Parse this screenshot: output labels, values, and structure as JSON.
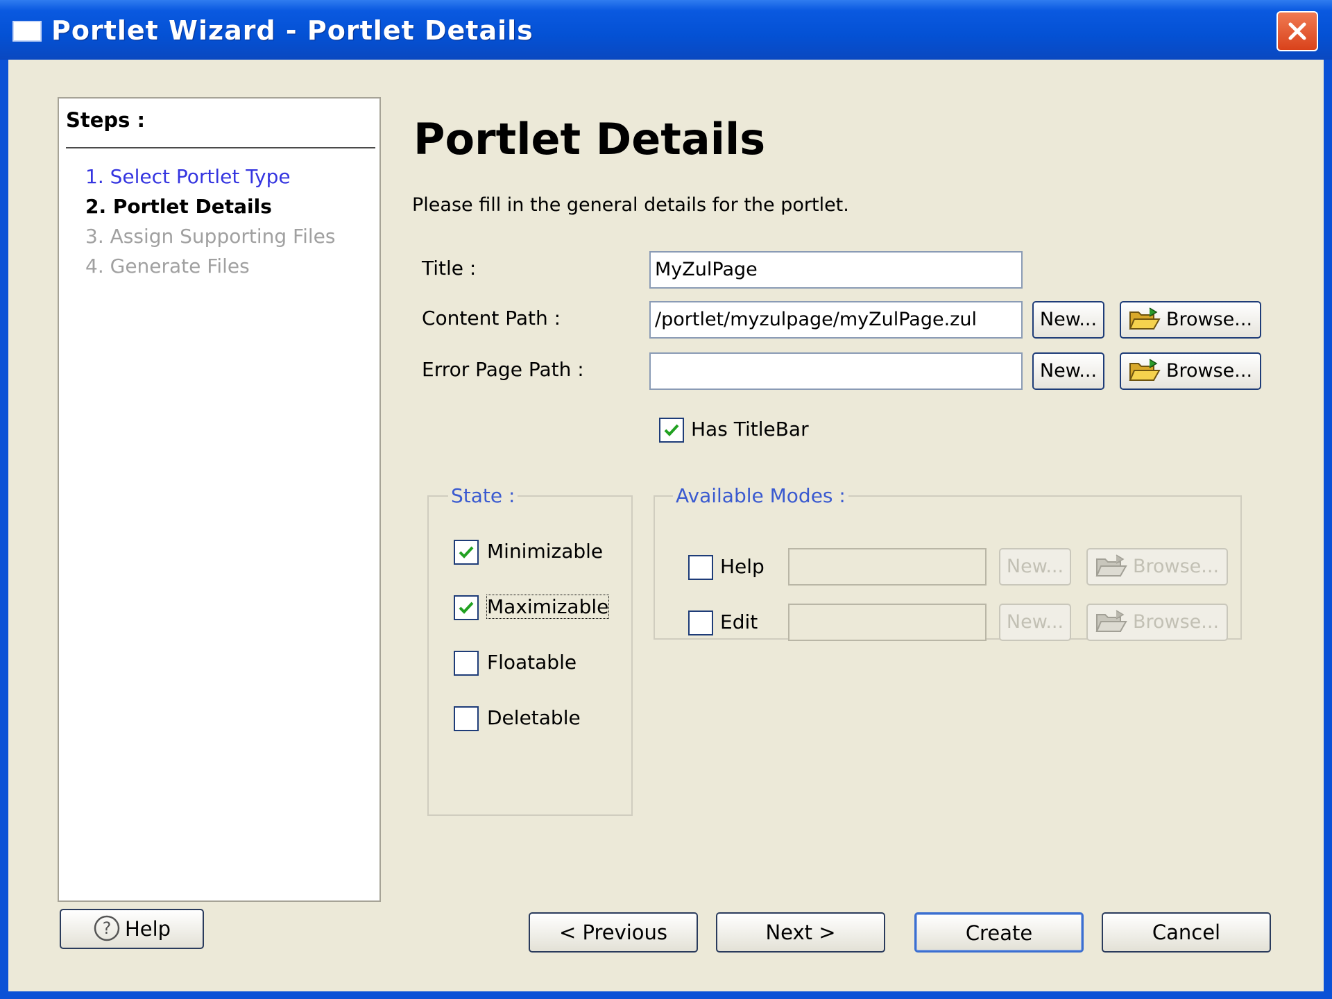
{
  "window": {
    "title": "Portlet Wizard - Portlet Details"
  },
  "steps": {
    "heading": "Steps :",
    "items": [
      {
        "label": "1. Select Portlet Type",
        "status": "completed"
      },
      {
        "label": "2. Portlet Details",
        "status": "current"
      },
      {
        "label": "3. Assign Supporting Files",
        "status": "pending"
      },
      {
        "label": "4. Generate Files",
        "status": "pending"
      }
    ]
  },
  "main": {
    "title": "Portlet Details",
    "subtitle": "Please fill in the general details for the portlet.",
    "fields": {
      "title_label": "Title :",
      "title_value": "MyZulPage",
      "content_path_label": "Content Path :",
      "content_path_value": "/portlet/myzulpage/myZulPage.zul",
      "error_page_label": "Error Page Path :",
      "error_page_value": ""
    },
    "new_label": "New...",
    "browse_label": "Browse...",
    "has_titlebar": {
      "label": "Has TitleBar",
      "checked": true
    }
  },
  "state": {
    "title": "State :",
    "options": [
      {
        "label": "Minimizable",
        "checked": true
      },
      {
        "label": "Maximizable",
        "checked": true,
        "focused": true
      },
      {
        "label": "Floatable",
        "checked": false
      },
      {
        "label": "Deletable",
        "checked": false
      }
    ]
  },
  "modes": {
    "title": "Available Modes :",
    "items": [
      {
        "label": "Help",
        "checked": false,
        "value": ""
      },
      {
        "label": "Edit",
        "checked": false,
        "value": ""
      }
    ]
  },
  "footer": {
    "help_label": "Help",
    "previous_label": "< Previous",
    "next_label": "Next >",
    "create_label": "Create",
    "cancel_label": "Cancel"
  },
  "colors": {
    "titlebar": "#0451d4",
    "dialog_bg": "#ece9d8",
    "link_blue": "#3535e0",
    "checkmark": "#21a121"
  },
  "icons": {
    "window": "window-icon",
    "close": "close-icon",
    "folder": "open-folder-icon",
    "help": "question-icon",
    "check": "checkmark-icon"
  }
}
